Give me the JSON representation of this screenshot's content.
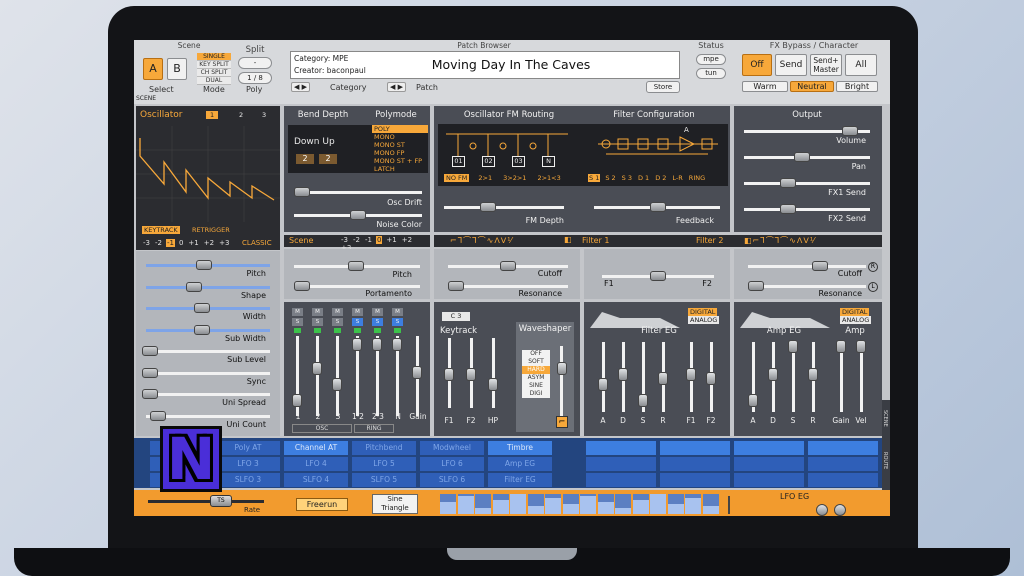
{
  "header": {
    "scene_title": "Scene",
    "scene_a": "A",
    "scene_b": "B",
    "select_label": "Select",
    "split_title": "Split",
    "split_value": "-",
    "mode_label": "Mode",
    "mode_options": [
      "SINGLE",
      "KEY SPLIT",
      "CH SPLIT",
      "DUAL"
    ],
    "poly_value": "1 / 8",
    "poly_label": "Poly",
    "patch_browser_title": "Patch Browser",
    "category_line": "Category: MPE",
    "creator_line": "Creator: baconpaul",
    "patch_name": "Moving Day In The Caves",
    "category_label": "Category",
    "patch_label": "Patch",
    "store_label": "Store",
    "status_title": "Status",
    "status_mpe": "mpe",
    "status_tun": "tun",
    "fx_title": "FX Bypass / Character",
    "fx_off": "Off",
    "fx_send": "Send",
    "fx_send_master": "Send+ Master",
    "fx_all": "All",
    "char_warm": "Warm",
    "char_neutral": "Neutral",
    "char_bright": "Bright",
    "scene_strip_label": "SCENE"
  },
  "osc": {
    "title": "Oscillator",
    "tabs": [
      "1",
      "2",
      "3"
    ],
    "keytrack": "KEYTRACK",
    "retrigger": "RETRIGGER",
    "octave_values": [
      "-3",
      "-2",
      "-1",
      "0",
      "+1",
      "+2",
      "+3"
    ],
    "octave_selected": "-1",
    "type": "CLASSIC",
    "params": [
      "Pitch",
      "Shape",
      "Width",
      "Sub Width",
      "Sub Level",
      "Sync",
      "Uni Spread",
      "Uni Count"
    ]
  },
  "bend": {
    "title": "Bend Depth",
    "direction": "Down Up",
    "down": "2",
    "up": "2",
    "polymode_title": "Polymode",
    "polymodes": [
      "POLY",
      "MONO",
      "MONO ST",
      "MONO FP",
      "MONO ST + FP",
      "LATCH"
    ],
    "polymode_selected": "POLY",
    "osc_drift": "Osc Drift",
    "noise_color": "Noise Color"
  },
  "fm": {
    "title": "Oscillator FM Routing",
    "nodes": [
      "01",
      "02",
      "03",
      "N"
    ],
    "routes": [
      "NO FM",
      "2>1",
      "3>2>1",
      "2>1<3"
    ],
    "route_selected": "NO FM",
    "fm_depth": "FM Depth"
  },
  "filter_cfg": {
    "title": "Filter Configuration",
    "configs": [
      "S 1",
      "S 2",
      "S 3",
      "D 1",
      "D 2",
      "L-R",
      "RING"
    ],
    "config_selected": "S 1",
    "node_a": "A",
    "feedback": "Feedback"
  },
  "output": {
    "title": "Output",
    "params": [
      "Volume",
      "Pan",
      "FX1 Send",
      "FX2 Send"
    ]
  },
  "scene_row": {
    "title": "Scene",
    "octaves": [
      "-3",
      "-2",
      "-1",
      "0",
      "+1",
      "+2",
      "+3"
    ],
    "selected": "0",
    "pitch": "Pitch",
    "portamento": "Portamento"
  },
  "filters": {
    "filter1": "Filter 1",
    "filter2": "Filter 2",
    "cutoff": "Cutoff",
    "resonance": "Resonance",
    "f1": "F1",
    "f2": "F2",
    "r_badge": "R",
    "l_badge": "L"
  },
  "mixer": {
    "channels": [
      "1",
      "2",
      "3",
      "1·2",
      "2·3",
      "N",
      "Gain"
    ],
    "osc_group": "OSC",
    "ring_group": "RING"
  },
  "keytrack": {
    "note": "C 3",
    "title": "Keytrack",
    "labels": [
      "F1",
      "F2",
      "HP"
    ]
  },
  "waveshaper": {
    "title": "Waveshaper",
    "types": [
      "OFF",
      "SOFT",
      "HARD",
      "ASYM",
      "SINE",
      "DIGI"
    ],
    "selected": "HARD"
  },
  "filter_eg": {
    "title": "Filter EG",
    "digital": "DIGITAL",
    "analog": "ANALOG",
    "labels": [
      "A",
      "D",
      "S",
      "R",
      "F1",
      "F2"
    ]
  },
  "amp_eg": {
    "title": "Amp EG",
    "amp_title": "Amp",
    "digital": "DIGITAL",
    "analog": "ANALOG",
    "labels": [
      "A",
      "D",
      "S",
      "R",
      "Gain",
      "Vel"
    ]
  },
  "mod": {
    "row1": [
      "Keytrack",
      "Poly AT",
      "Channel AT",
      "Pitchbend",
      "Modwheel",
      "Timbre"
    ],
    "row2": [
      "LFO 2",
      "LFO 3",
      "LFO 4",
      "LFO 5",
      "LFO 6",
      "Amp EG"
    ],
    "row3": [
      "SLFO 2",
      "SLFO 3",
      "SLFO 4",
      "SLFO 5",
      "SLFO 6",
      "Filter EG"
    ],
    "side_scene": "SCENE",
    "side_route": "ROUTE"
  },
  "lfo": {
    "rate": "Rate",
    "freerun": "Freerun",
    "shape_top": "Sine",
    "shape_bottom": "Triangle",
    "eg": "LFO EG",
    "rate_badge": "TS"
  },
  "overlay": {
    "letter": "N"
  },
  "colors": {
    "accent": "#f7a83a",
    "panel": "#a8acb2",
    "dark": "#4c5058",
    "mod_blue": "#2f5fb8"
  }
}
